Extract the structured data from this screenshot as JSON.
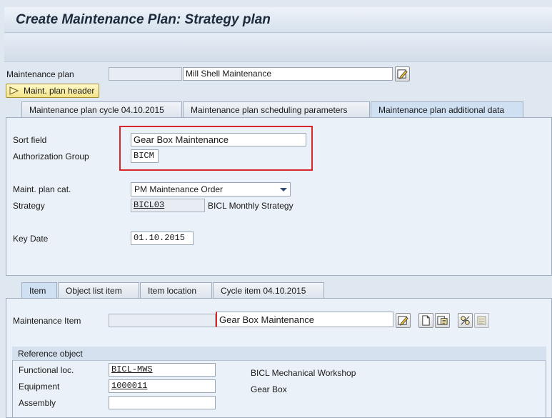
{
  "window": {
    "title": "Create Maintenance Plan: Strategy plan"
  },
  "header": {
    "plan_label": "Maintenance plan",
    "plan_number": "",
    "plan_description": "Mill Shell Maintenance",
    "header_button_label": "Maint. plan header"
  },
  "tabs": [
    {
      "label": "Maintenance plan cycle 04.10.2015",
      "active": false
    },
    {
      "label": "Maintenance plan scheduling parameters",
      "active": false
    },
    {
      "label": "Maintenance plan additional data",
      "active": true
    }
  ],
  "additional": {
    "sort_field_label": "Sort field",
    "sort_field_value": "Gear Box Maintenance",
    "auth_group_label": "Authorization Group",
    "auth_group_value": "BICM",
    "plan_cat_label": "Maint. plan cat.",
    "plan_cat_value": "PM Maintenance Order",
    "strategy_label": "Strategy",
    "strategy_value": "BICL03",
    "strategy_description": "BICL Monthly Strategy",
    "key_date_label": "Key Date",
    "key_date_value": "01.10.2015"
  },
  "item_tabs": [
    {
      "label": "Item",
      "active": true
    },
    {
      "label": "Object list item",
      "active": false
    },
    {
      "label": "Item location",
      "active": false
    },
    {
      "label": "Cycle item 04.10.2015",
      "active": false
    }
  ],
  "item": {
    "label": "Maintenance Item",
    "number": "",
    "description": "Gear Box Maintenance"
  },
  "reference": {
    "header": "Reference object",
    "func_loc_label": "Functional loc.",
    "func_loc_value": "BICL-MWS",
    "func_loc_description": "BICL Mechanical Workshop",
    "equipment_label": "Equipment",
    "equipment_value": "1000011",
    "equipment_description": "Gear Box",
    "assembly_label": "Assembly",
    "assembly_value": ""
  },
  "icons": [
    "edit-long-text-icon",
    "create-icon",
    "display-object-icon",
    "task-list-icon",
    "overview-icon"
  ],
  "colors": {
    "highlight": "#d8262b",
    "panel": "#ebf1f8",
    "header_button": "#f3e38a"
  }
}
